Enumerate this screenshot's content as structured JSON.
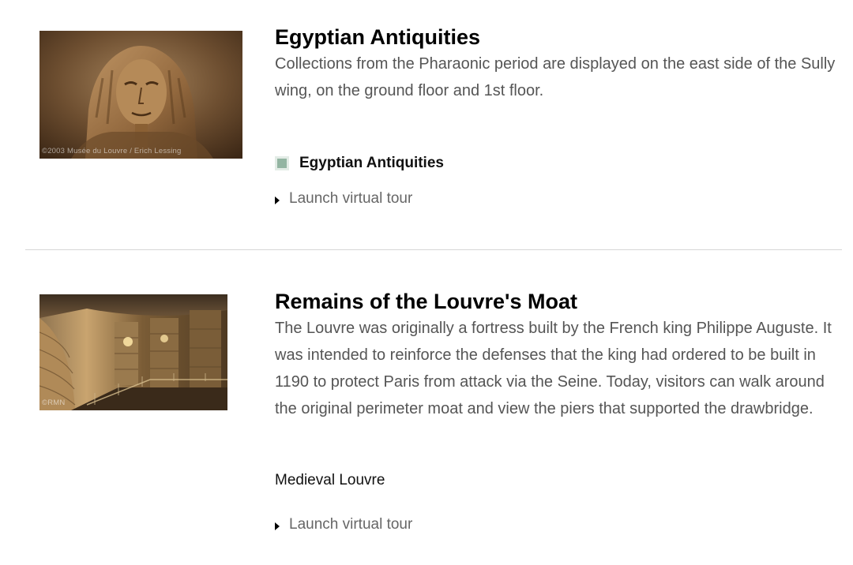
{
  "entries": [
    {
      "title": "Egyptian Antiquities",
      "description": "Collections from the Pharaonic period are displayed on the east side of the Sully wing, on the ground floor and 1st floor.",
      "image_credit": "©2003 Musée du Louvre / Erich Lessing",
      "department": "Egyptian Antiquities",
      "tour_label": "Launch virtual tour",
      "swatch_color": "#93b5a2"
    },
    {
      "title": "Remains of the Louvre's Moat",
      "description": "The Louvre was originally a fortress built by the French king Philippe Auguste. It was intended to reinforce the defenses that the king had ordered to be built in 1190 to protect Paris from attack via the Seine. Today, visitors can walk around the original perimeter moat and view the piers that supported the drawbridge.",
      "image_credit": "©RMN",
      "department": "Medieval Louvre",
      "tour_label": "Launch virtual tour"
    }
  ]
}
